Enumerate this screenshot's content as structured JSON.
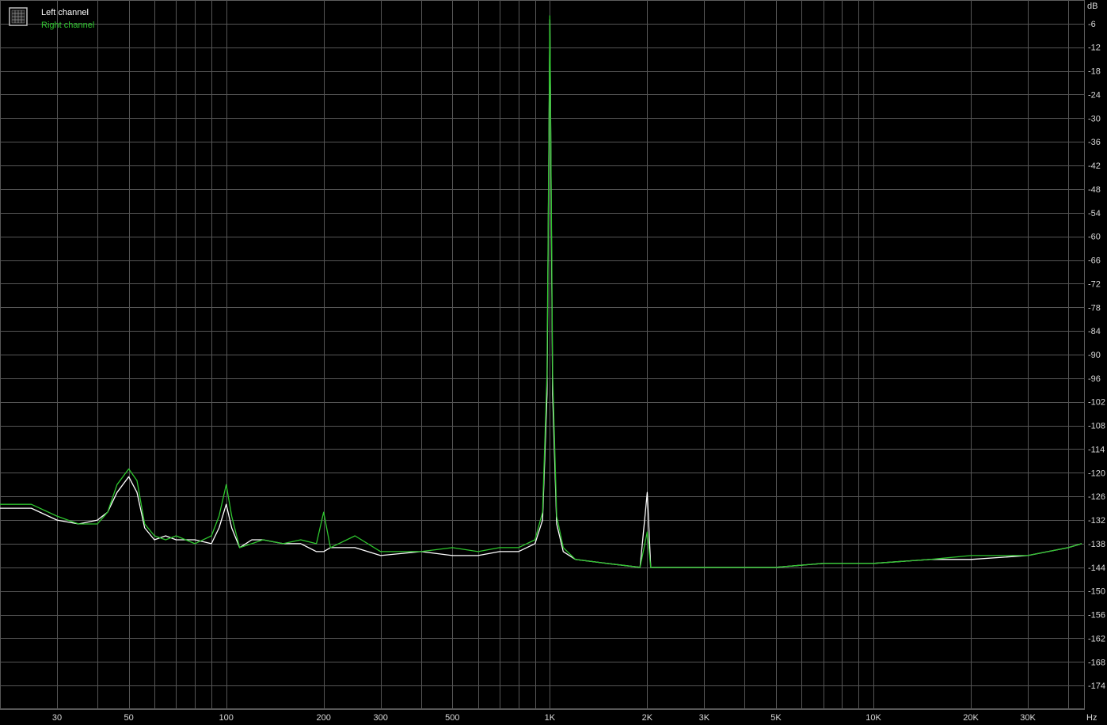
{
  "chart_data": {
    "type": "line",
    "title": "",
    "x_unit_label": "Hz",
    "y_unit_label": "dB",
    "x_scale": "log",
    "xlim": [
      20,
      45000
    ],
    "ylim": [
      -180,
      0
    ],
    "grid": true,
    "legend_position": "top-left",
    "x_tick_values": [
      30,
      50,
      100,
      200,
      300,
      500,
      1000,
      2000,
      3000,
      5000,
      10000,
      20000,
      30000
    ],
    "x_tick_labels": [
      "30",
      "50",
      "100",
      "200",
      "300",
      "500",
      "1K",
      "2K",
      "3K",
      "5K",
      "10K",
      "20K",
      "30K"
    ],
    "y_tick_values": [
      -6,
      -12,
      -18,
      -24,
      -30,
      -36,
      -42,
      -48,
      -54,
      -60,
      -66,
      -72,
      -78,
      -84,
      -90,
      -96,
      -102,
      -108,
      -114,
      -120,
      -126,
      -132,
      -138,
      -144,
      -150,
      -156,
      -162,
      -168,
      -174
    ],
    "y_tick_labels": [
      "-6",
      "-12",
      "-18",
      "-24",
      "-30",
      "-36",
      "-42",
      "-48",
      "-54",
      "-60",
      "-66",
      "-72",
      "-78",
      "-84",
      "-90",
      "-96",
      "-102",
      "-108",
      "-114",
      "-120",
      "-126",
      "-132",
      "-138",
      "-144",
      "-150",
      "-156",
      "-162",
      "-168",
      "-174"
    ],
    "series": [
      {
        "name": "Left channel",
        "color": "#ffffff",
        "points": [
          [
            20,
            -129
          ],
          [
            25,
            -129
          ],
          [
            30,
            -132
          ],
          [
            35,
            -133
          ],
          [
            40,
            -132
          ],
          [
            43,
            -130
          ],
          [
            46,
            -125
          ],
          [
            50,
            -121
          ],
          [
            53,
            -125
          ],
          [
            56,
            -134
          ],
          [
            60,
            -137
          ],
          [
            65,
            -136
          ],
          [
            70,
            -137
          ],
          [
            80,
            -137
          ],
          [
            90,
            -138
          ],
          [
            95,
            -134
          ],
          [
            100,
            -128
          ],
          [
            104,
            -134
          ],
          [
            110,
            -139
          ],
          [
            120,
            -137
          ],
          [
            130,
            -137
          ],
          [
            150,
            -138
          ],
          [
            170,
            -138
          ],
          [
            190,
            -140
          ],
          [
            200,
            -140
          ],
          [
            210,
            -139
          ],
          [
            250,
            -139
          ],
          [
            300,
            -141
          ],
          [
            400,
            -140
          ],
          [
            500,
            -141
          ],
          [
            600,
            -141
          ],
          [
            700,
            -140
          ],
          [
            800,
            -140
          ],
          [
            900,
            -138
          ],
          [
            950,
            -132
          ],
          [
            980,
            -100
          ],
          [
            1000,
            -5
          ],
          [
            1020,
            -100
          ],
          [
            1050,
            -133
          ],
          [
            1100,
            -140
          ],
          [
            1200,
            -142
          ],
          [
            1500,
            -143
          ],
          [
            1900,
            -144
          ],
          [
            2000,
            -125
          ],
          [
            2050,
            -144
          ],
          [
            2500,
            -144
          ],
          [
            3000,
            -144
          ],
          [
            5000,
            -144
          ],
          [
            7000,
            -143
          ],
          [
            10000,
            -143
          ],
          [
            15000,
            -142
          ],
          [
            20000,
            -142
          ],
          [
            30000,
            -141
          ],
          [
            40000,
            -139
          ],
          [
            44000,
            -138
          ]
        ]
      },
      {
        "name": "Right channel",
        "color": "#2ec52e",
        "points": [
          [
            20,
            -128
          ],
          [
            25,
            -128
          ],
          [
            30,
            -131
          ],
          [
            35,
            -133
          ],
          [
            40,
            -133
          ],
          [
            43,
            -130
          ],
          [
            46,
            -123
          ],
          [
            50,
            -119
          ],
          [
            53,
            -122
          ],
          [
            56,
            -133
          ],
          [
            60,
            -136
          ],
          [
            65,
            -137
          ],
          [
            70,
            -136
          ],
          [
            80,
            -138
          ],
          [
            90,
            -136
          ],
          [
            95,
            -131
          ],
          [
            100,
            -123
          ],
          [
            104,
            -131
          ],
          [
            110,
            -139
          ],
          [
            120,
            -138
          ],
          [
            130,
            -137
          ],
          [
            150,
            -138
          ],
          [
            170,
            -137
          ],
          [
            190,
            -138
          ],
          [
            200,
            -130
          ],
          [
            210,
            -139
          ],
          [
            250,
            -136
          ],
          [
            300,
            -140
          ],
          [
            400,
            -140
          ],
          [
            500,
            -139
          ],
          [
            600,
            -140
          ],
          [
            700,
            -139
          ],
          [
            800,
            -139
          ],
          [
            900,
            -137
          ],
          [
            950,
            -130
          ],
          [
            980,
            -95
          ],
          [
            1000,
            -4
          ],
          [
            1020,
            -95
          ],
          [
            1050,
            -131
          ],
          [
            1100,
            -139
          ],
          [
            1200,
            -142
          ],
          [
            1500,
            -143
          ],
          [
            1900,
            -144
          ],
          [
            2000,
            -135
          ],
          [
            2050,
            -144
          ],
          [
            2500,
            -144
          ],
          [
            3000,
            -144
          ],
          [
            5000,
            -144
          ],
          [
            7000,
            -143
          ],
          [
            10000,
            -143
          ],
          [
            15000,
            -142
          ],
          [
            20000,
            -141
          ],
          [
            30000,
            -141
          ],
          [
            40000,
            -139
          ],
          [
            44000,
            -138
          ]
        ]
      }
    ]
  }
}
